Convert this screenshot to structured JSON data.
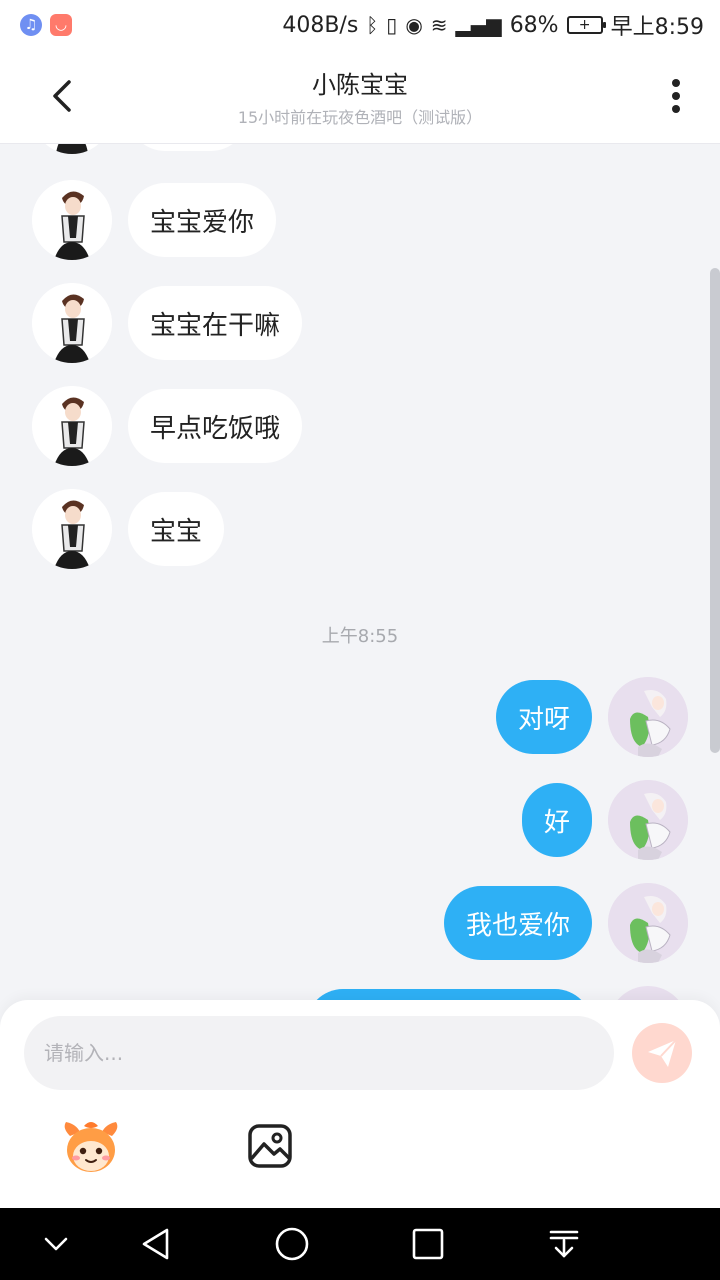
{
  "status_bar": {
    "network_speed": "408B/s",
    "battery": "68%",
    "time": "早上8:59"
  },
  "header": {
    "title": "小陈宝宝",
    "subtitle": "15小时前在玩夜色酒吧（测试版）"
  },
  "messages": {
    "timestamp": "上午8:55",
    "incoming": [
      {
        "text": "宝宝爱你"
      },
      {
        "text": "宝宝在干嘛"
      },
      {
        "text": "早点吃饭哦"
      },
      {
        "text": "宝宝"
      }
    ],
    "outgoing": [
      {
        "text": "对呀"
      },
      {
        "text": "好"
      },
      {
        "text": "我也爱你"
      }
    ]
  },
  "input": {
    "placeholder": "请输入..."
  },
  "colors": {
    "outgoing_bubble": "#2eb0f5",
    "incoming_bubble": "#ffffff",
    "send_button": "#ffd8cf",
    "background": "#f3f4f7"
  },
  "icons": {
    "back": "chevron-left-icon",
    "more": "more-vertical-icon",
    "send": "paper-plane-icon",
    "emoji": "emoji-mascot-icon",
    "image": "image-icon"
  }
}
